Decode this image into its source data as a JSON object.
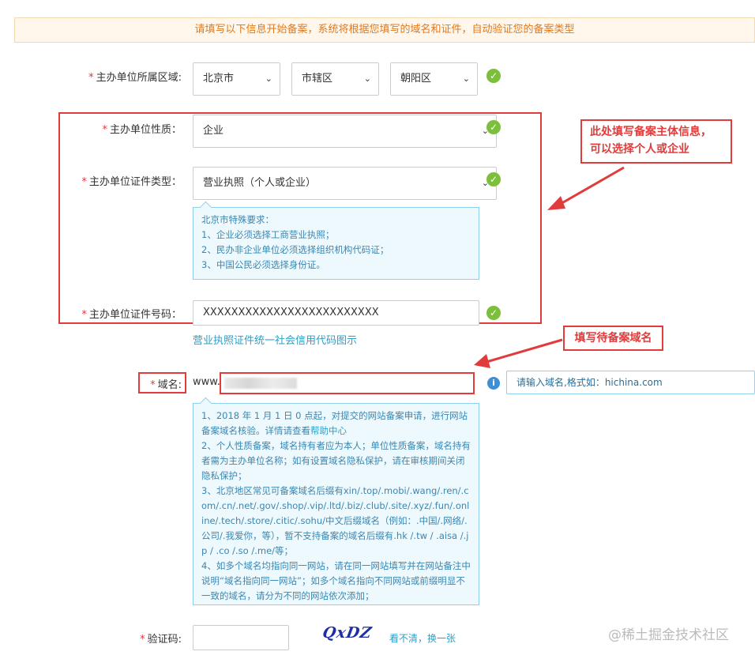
{
  "banner": "请填写以下信息开始备案，系统将根据您填写的域名和证件，自动验证您的备案类型",
  "region": {
    "star": "*",
    "label": "主办单位所属区域:",
    "province": "北京市",
    "city": "市辖区",
    "district": "朝阳区"
  },
  "nature": {
    "star": "*",
    "label": "主办单位性质：",
    "value": "企业"
  },
  "cert_type": {
    "star": "*",
    "label": "主办单位证件类型：",
    "value": "营业执照（个人或企业）"
  },
  "beijing_notice": [
    "北京市特殊要求：",
    "1、企业必须选择工商营业执照；",
    "2、民办非企业单位必须选择组织机构代码证；",
    "3、中国公民必须选择身份证。"
  ],
  "cert_number": {
    "star": "*",
    "label": "主办单位证件号码：",
    "value": "XXXXXXXXXXXXXXXXXXXXXXXXX"
  },
  "cert_sample_link": "营业执照证件统一社会信用代码图示",
  "domain": {
    "star": "*",
    "label": "域名:",
    "prefix": "www.",
    "tooltip": "请输入域名,格式如：hichina.com"
  },
  "domain_notice": {
    "line1a": "1、2018 年 1 月 1 日 0 点起，对提交的网站备案申请，进行网站备案域名核验。详情请查看",
    "line1_link": "帮助中心",
    "rest": [
      "2、个人性质备案，域名持有者应为本人；单位性质备案，域名持有者需为主办单位名称；如有设置域名隐私保护，请在审核期间关闭隐私保护；",
      "3、北京地区常见可备案域名后缀有xin/.top/.mobi/.wang/.ren/.com/.cn/.net/.gov/.shop/.vip/.ltd/.biz/.club/.site/.xyz/.fun/.online/.tech/.store/.citic/.sohu/中文后缀域名（例如：.中国/.网络/.公司/.我爱你，等），暂不支持备案的域名后缀有.hk /.tw / .aisa /.jp / .co /.so /.me/等；",
      "4、如多个域名均指向同一网站，请在同一网站填写并在网站备注中说明“域名指向同一网站”；如多个域名指向不同网站或前缀明显不一致的域名，请分为不同的网站依次添加；"
    ]
  },
  "captcha": {
    "star": "*",
    "label": "验证码:",
    "image_text": "QxDZ",
    "refresh": "看不清，换一张"
  },
  "callouts": {
    "subject": [
      "此处填写备案主体信息，",
      "可以选择个人或企业"
    ],
    "domain": "填写待备案域名"
  },
  "watermark": "@稀土掘金技术社区",
  "colors": {
    "accent_red": "#e23b3b",
    "check_green": "#7cbf3a",
    "link_blue": "#2aa0c8",
    "banner_orange": "#e07a1f"
  },
  "icons": {
    "valid": "check-circle-icon",
    "info": "info-circle-icon",
    "dropdown": "chevron-down-icon"
  }
}
